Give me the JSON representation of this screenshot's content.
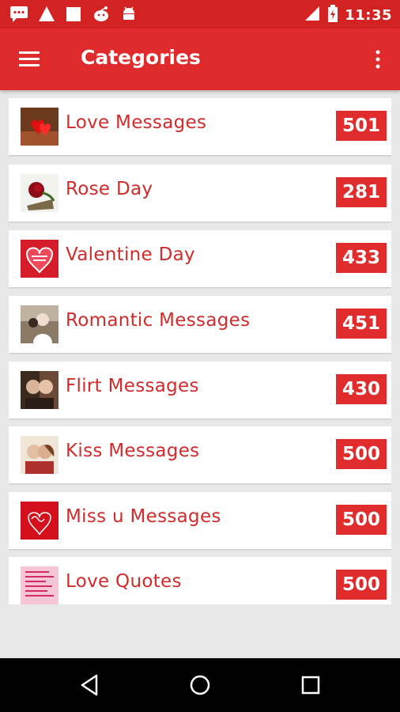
{
  "status_bar": {
    "time": "11:35",
    "icons": [
      "chat-icon",
      "warning-icon",
      "square-icon",
      "reddit-icon",
      "android-icon",
      "signal-icon",
      "battery-icon"
    ]
  },
  "app_bar": {
    "title": "Categories",
    "icons": [
      "menu-icon",
      "more-vert-icon"
    ]
  },
  "categories": [
    {
      "label": "Love Messages",
      "count": "501",
      "icon": "hearts-thumbnail"
    },
    {
      "label": "Rose Day",
      "count": "281",
      "icon": "rose-thumbnail"
    },
    {
      "label": "Valentine Day",
      "count": "433",
      "icon": "valentine-heart-thumbnail"
    },
    {
      "label": "Romantic Messages",
      "count": "451",
      "icon": "couple-thumbnail"
    },
    {
      "label": "Flirt Messages",
      "count": "430",
      "icon": "flirt-couple-thumbnail"
    },
    {
      "label": "Kiss Messages",
      "count": "500",
      "icon": "kiss-thumbnail"
    },
    {
      "label": "Miss u Messages",
      "count": "500",
      "icon": "miss-you-thumbnail"
    },
    {
      "label": "Love Quotes",
      "count": "500",
      "icon": "quotes-thumbnail"
    }
  ],
  "nav_bar": {
    "icons": [
      "back-icon",
      "home-icon",
      "recents-icon"
    ]
  },
  "colors": {
    "accent": "#df2b2b",
    "status_bar": "#d22222",
    "label_text": "#d22b2b",
    "background": "#e8e8e8"
  }
}
